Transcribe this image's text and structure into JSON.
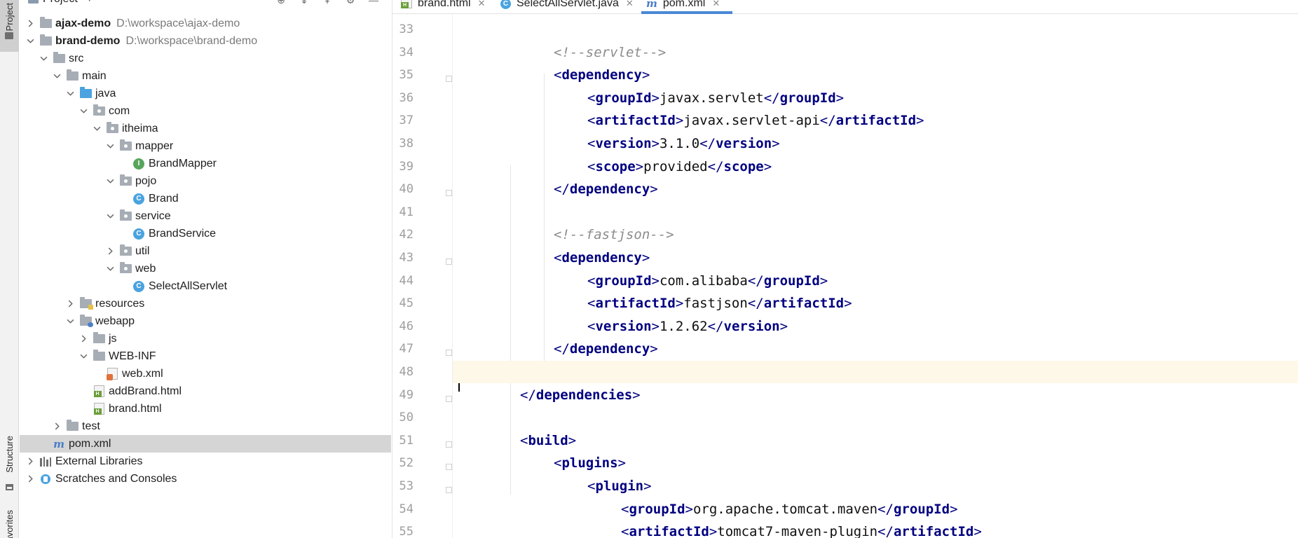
{
  "sidebar_strip": {
    "project_tab": "Project",
    "structure_tab": "Structure",
    "favorites_tab": "Favorites"
  },
  "project_panel": {
    "title": "Project",
    "tree": [
      {
        "label": "ajax-demo",
        "path": "D:\\workspace\\ajax-demo",
        "bold": true,
        "depth": 0,
        "arrow": "right",
        "icon": "module-folder-icon"
      },
      {
        "label": "brand-demo",
        "path": "D:\\workspace\\brand-demo",
        "bold": true,
        "depth": 0,
        "arrow": "down",
        "icon": "module-folder-icon"
      },
      {
        "label": "src",
        "depth": 1,
        "arrow": "down",
        "icon": "folder-icon"
      },
      {
        "label": "main",
        "depth": 2,
        "arrow": "down",
        "icon": "folder-icon"
      },
      {
        "label": "java",
        "depth": 3,
        "arrow": "down",
        "icon": "source-folder-icon"
      },
      {
        "label": "com",
        "depth": 4,
        "arrow": "down",
        "icon": "package-icon"
      },
      {
        "label": "itheima",
        "depth": 5,
        "arrow": "down",
        "icon": "package-icon"
      },
      {
        "label": "mapper",
        "depth": 6,
        "arrow": "down",
        "icon": "package-icon"
      },
      {
        "label": "BrandMapper",
        "depth": 7,
        "arrow": "none",
        "icon": "interface-icon"
      },
      {
        "label": "pojo",
        "depth": 6,
        "arrow": "down",
        "icon": "package-icon"
      },
      {
        "label": "Brand",
        "depth": 7,
        "arrow": "none",
        "icon": "class-icon"
      },
      {
        "label": "service",
        "depth": 6,
        "arrow": "down",
        "icon": "package-icon"
      },
      {
        "label": "BrandService",
        "depth": 7,
        "arrow": "none",
        "icon": "class-icon"
      },
      {
        "label": "util",
        "depth": 6,
        "arrow": "right",
        "icon": "package-icon"
      },
      {
        "label": "web",
        "depth": 6,
        "arrow": "down",
        "icon": "package-icon"
      },
      {
        "label": "SelectAllServlet",
        "depth": 7,
        "arrow": "none",
        "icon": "class-icon"
      },
      {
        "label": "resources",
        "depth": 3,
        "arrow": "right",
        "icon": "resources-folder-icon"
      },
      {
        "label": "webapp",
        "depth": 3,
        "arrow": "down",
        "icon": "web-folder-icon"
      },
      {
        "label": "js",
        "depth": 4,
        "arrow": "right",
        "icon": "folder-icon"
      },
      {
        "label": "WEB-INF",
        "depth": 4,
        "arrow": "down",
        "icon": "folder-icon"
      },
      {
        "label": "web.xml",
        "depth": 5,
        "arrow": "none",
        "icon": "xml-file-icon"
      },
      {
        "label": "addBrand.html",
        "depth": 4,
        "arrow": "none",
        "icon": "html-file-icon"
      },
      {
        "label": "brand.html",
        "depth": 4,
        "arrow": "none",
        "icon": "html-file-icon"
      },
      {
        "label": "test",
        "depth": 2,
        "arrow": "right",
        "icon": "folder-icon"
      },
      {
        "label": "pom.xml",
        "depth": 1,
        "arrow": "none",
        "icon": "maven-file-icon",
        "selected": true
      },
      {
        "label": "External Libraries",
        "depth": 0,
        "arrow": "right",
        "icon": "libraries-icon"
      },
      {
        "label": "Scratches and Consoles",
        "depth": 0,
        "arrow": "right",
        "icon": "scratches-icon"
      }
    ]
  },
  "editor": {
    "tabs": [
      {
        "label": "brand.html",
        "active": false
      },
      {
        "label": "SelectAllServlet.java",
        "active": false
      },
      {
        "label": "pom.xml",
        "active": true
      }
    ],
    "current_line": 48,
    "lines": [
      {
        "n": "33",
        "indent": 0,
        "parts": []
      },
      {
        "n": "34",
        "indent": 2,
        "parts": [
          [
            "cmt",
            "<!--servlet-->"
          ]
        ]
      },
      {
        "n": "35",
        "indent": 2,
        "parts": [
          [
            "b",
            "<"
          ],
          [
            "n",
            "dependency"
          ],
          [
            "b",
            ">"
          ]
        ]
      },
      {
        "n": "36",
        "indent": 3,
        "parts": [
          [
            "b",
            "<"
          ],
          [
            "n",
            "groupId"
          ],
          [
            "b",
            ">"
          ],
          [
            "t",
            "javax.servlet"
          ],
          [
            "b",
            "</"
          ],
          [
            "n",
            "groupId"
          ],
          [
            "b",
            ">"
          ]
        ]
      },
      {
        "n": "37",
        "indent": 3,
        "parts": [
          [
            "b",
            "<"
          ],
          [
            "n",
            "artifactId"
          ],
          [
            "b",
            ">"
          ],
          [
            "t",
            "javax.servlet-api"
          ],
          [
            "b",
            "</"
          ],
          [
            "n",
            "artifactId"
          ],
          [
            "b",
            ">"
          ]
        ]
      },
      {
        "n": "38",
        "indent": 3,
        "parts": [
          [
            "b",
            "<"
          ],
          [
            "n",
            "version"
          ],
          [
            "b",
            ">"
          ],
          [
            "t",
            "3.1.0"
          ],
          [
            "b",
            "</"
          ],
          [
            "n",
            "version"
          ],
          [
            "b",
            ">"
          ]
        ]
      },
      {
        "n": "39",
        "indent": 3,
        "parts": [
          [
            "b",
            "<"
          ],
          [
            "n",
            "scope"
          ],
          [
            "b",
            ">"
          ],
          [
            "t",
            "provided"
          ],
          [
            "b",
            "</"
          ],
          [
            "n",
            "scope"
          ],
          [
            "b",
            ">"
          ]
        ]
      },
      {
        "n": "40",
        "indent": 2,
        "parts": [
          [
            "b",
            "</"
          ],
          [
            "n",
            "dependency"
          ],
          [
            "b",
            ">"
          ]
        ]
      },
      {
        "n": "41",
        "indent": 0,
        "parts": []
      },
      {
        "n": "42",
        "indent": 2,
        "parts": [
          [
            "cmt",
            "<!--fastjson-->"
          ]
        ]
      },
      {
        "n": "43",
        "indent": 2,
        "parts": [
          [
            "b",
            "<"
          ],
          [
            "n",
            "dependency"
          ],
          [
            "b",
            ">"
          ]
        ]
      },
      {
        "n": "44",
        "indent": 3,
        "parts": [
          [
            "b",
            "<"
          ],
          [
            "n",
            "groupId"
          ],
          [
            "b",
            ">"
          ],
          [
            "t",
            "com.alibaba"
          ],
          [
            "b",
            "</"
          ],
          [
            "n",
            "groupId"
          ],
          [
            "b",
            ">"
          ]
        ]
      },
      {
        "n": "45",
        "indent": 3,
        "parts": [
          [
            "b",
            "<"
          ],
          [
            "n",
            "artifactId"
          ],
          [
            "b",
            ">"
          ],
          [
            "t",
            "fastjson"
          ],
          [
            "b",
            "</"
          ],
          [
            "n",
            "artifactId"
          ],
          [
            "b",
            ">"
          ]
        ]
      },
      {
        "n": "46",
        "indent": 3,
        "parts": [
          [
            "b",
            "<"
          ],
          [
            "n",
            "version"
          ],
          [
            "b",
            ">"
          ],
          [
            "t",
            "1.2.62"
          ],
          [
            "b",
            "</"
          ],
          [
            "n",
            "version"
          ],
          [
            "b",
            ">"
          ]
        ]
      },
      {
        "n": "47",
        "indent": 2,
        "parts": [
          [
            "b",
            "</"
          ],
          [
            "n",
            "dependency"
          ],
          [
            "b",
            ">"
          ]
        ]
      },
      {
        "n": "48",
        "indent": 0,
        "parts": []
      },
      {
        "n": "49",
        "indent": 1,
        "parts": [
          [
            "b",
            "</"
          ],
          [
            "n",
            "dependencies"
          ],
          [
            "b",
            ">"
          ]
        ]
      },
      {
        "n": "50",
        "indent": 0,
        "parts": []
      },
      {
        "n": "51",
        "indent": 1,
        "parts": [
          [
            "b",
            "<"
          ],
          [
            "n",
            "build"
          ],
          [
            "b",
            ">"
          ]
        ]
      },
      {
        "n": "52",
        "indent": 2,
        "parts": [
          [
            "b",
            "<"
          ],
          [
            "n",
            "plugins"
          ],
          [
            "b",
            ">"
          ]
        ]
      },
      {
        "n": "53",
        "indent": 3,
        "parts": [
          [
            "b",
            "<"
          ],
          [
            "n",
            "plugin"
          ],
          [
            "b",
            ">"
          ]
        ]
      },
      {
        "n": "54",
        "indent": 4,
        "parts": [
          [
            "b",
            "<"
          ],
          [
            "n",
            "groupId"
          ],
          [
            "b",
            ">"
          ],
          [
            "t",
            "org.apache.tomcat.maven"
          ],
          [
            "b",
            "</"
          ],
          [
            "n",
            "groupId"
          ],
          [
            "b",
            ">"
          ]
        ]
      },
      {
        "n": "55",
        "indent": 4,
        "parts": [
          [
            "b",
            "<"
          ],
          [
            "n",
            "artifactId"
          ],
          [
            "b",
            ">"
          ],
          [
            "t",
            "tomcat7-maven-plugin"
          ],
          [
            "b",
            "</"
          ],
          [
            "n",
            "artifactId"
          ],
          [
            "b",
            ">"
          ]
        ]
      }
    ],
    "fold_markers": [
      "35",
      "40",
      "43",
      "47",
      "49",
      "51",
      "52",
      "53"
    ]
  },
  "colors": {
    "selection": "#d5d5d5",
    "current_line": "#fdf8e7",
    "tag": "#000080",
    "comment": "#8c8c8c",
    "active_tab_underline": "#4a88d6"
  }
}
